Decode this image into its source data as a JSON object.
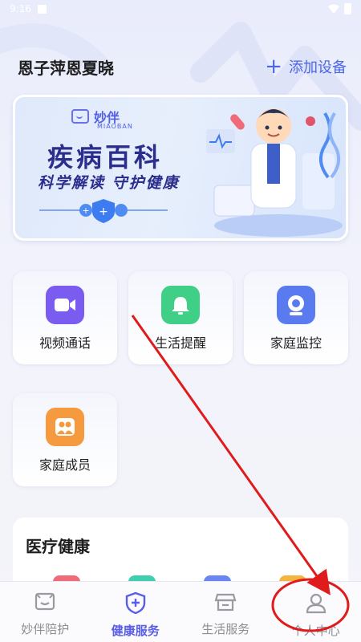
{
  "status_bar": {
    "time": "9:16"
  },
  "header": {
    "user_name": "恩子萍恩夏晓",
    "add_device_label": "添加设备",
    "add_icon": "plus-icon"
  },
  "banner": {
    "brand_name": "妙伴",
    "brand_sub": "MIAOBAN",
    "title": "疾病百科",
    "slogan": "科学解读 守护健康"
  },
  "services": [
    {
      "label": "视频通话",
      "icon": "video-camera-icon",
      "color": "#7b5cf0"
    },
    {
      "label": "生活提醒",
      "icon": "bell-icon",
      "color": "#3fcf86"
    },
    {
      "label": "家庭监控",
      "icon": "webcam-icon",
      "color": "#5a7bf0"
    },
    {
      "label": "家庭成员",
      "icon": "family-icon",
      "color": "#f59a3e"
    }
  ],
  "medical": {
    "title": "医疗健康"
  },
  "tabbar": {
    "tabs": [
      {
        "label": "妙伴陪护",
        "icon": "companion-icon",
        "active": false
      },
      {
        "label": "健康服务",
        "icon": "shield-plus-icon",
        "active": true
      },
      {
        "label": "生活服务",
        "icon": "store-icon",
        "active": false
      },
      {
        "label": "个人中心",
        "icon": "person-icon",
        "active": false
      }
    ]
  },
  "colors": {
    "accent": "#5a5de8",
    "annotation": "#e01b1b",
    "link": "#4a67e8"
  }
}
